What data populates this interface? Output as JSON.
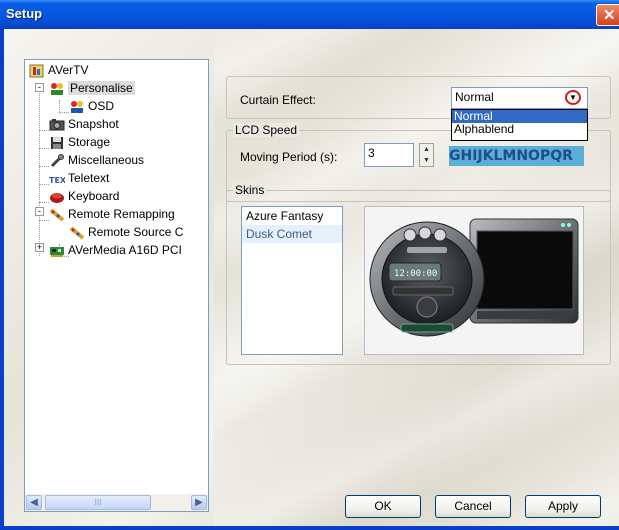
{
  "window": {
    "title": "Setup"
  },
  "tree": {
    "items": [
      {
        "label": "AVerTV",
        "icon": "avertv-app-icon"
      },
      {
        "label": "Personalise",
        "icon": "personalise-icon",
        "expander": "-"
      },
      {
        "label": "OSD",
        "icon": "osd-icon"
      },
      {
        "label": "Snapshot",
        "icon": "camera-icon"
      },
      {
        "label": "Storage",
        "icon": "floppy-disk-icon"
      },
      {
        "label": "Miscellaneous",
        "icon": "wrench-icon"
      },
      {
        "label": "Teletext",
        "icon": "teletext-icon"
      },
      {
        "label": "Keyboard",
        "icon": "keyboard-icon"
      },
      {
        "label": "Remote Remapping",
        "icon": "remote-icon",
        "expander": "-"
      },
      {
        "label": "Remote Source C",
        "icon": "remote-source-icon"
      },
      {
        "label": "AVerMedia A16D PCI",
        "icon": "pci-card-icon",
        "expander": "+"
      }
    ],
    "scroll_thumb_glyph": "III"
  },
  "curtain": {
    "label": "Curtain Effect:",
    "value": "Normal",
    "options": [
      "Normal",
      "Alphablend"
    ]
  },
  "lcd": {
    "group_label": "LCD Speed",
    "moving_label": "Moving Period (s):",
    "moving_value": "3",
    "preview_text": "GHIJKLMNOPQR"
  },
  "skins": {
    "group_label": "Skins",
    "items": [
      "Azure Fantasy",
      "Dusk Comet"
    ],
    "selected_index": 1,
    "preview_time": "12:00:00"
  },
  "buttons": {
    "ok": "OK",
    "cancel": "Cancel",
    "apply": "Apply"
  },
  "colors": {
    "titlebar": "#0757e0",
    "selection": "#316ac5",
    "lcd_bg": "#5aaed8",
    "close": "#d5401a"
  }
}
